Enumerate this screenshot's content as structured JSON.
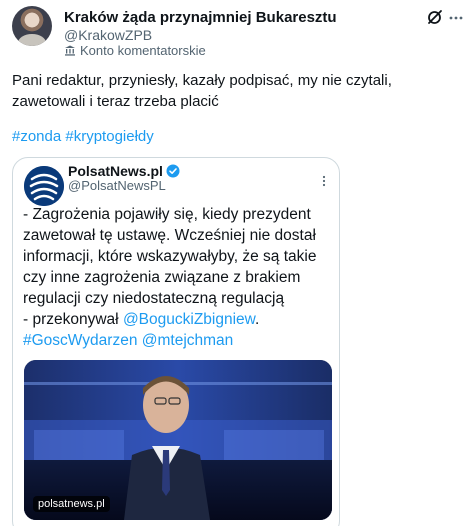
{
  "post": {
    "author_name": "Kraków żąda przynajmniej Bukaresztu",
    "author_handle": "@KrakowZPB",
    "account_type": "Konto komentatorskie",
    "icons": {
      "grok": "grok-icon",
      "more": "more-icon",
      "account": "bank-icon"
    },
    "text": "Pani redaktur, przyniesły, kazały podpisać, my nie czytali, zawetowali i teraz trzeba placić",
    "hashtags": "#zonda #kryptogiełdy"
  },
  "quote": {
    "name": "PolsatNews.pl",
    "handle": "@PolsatNewsPL",
    "verified_color": "#1d9bf0",
    "text_lines": [
      "- Zagrożenia pojawiły się, kiedy prezydent",
      "zawetował tę ustawę. Wcześniej nie dostał",
      "informacji, które wskazywałyby, że są takie",
      "czy inne zagrożenia związane z brakiem",
      "regulacji czy niedostateczną regulacją",
      "- przekonywał "
    ],
    "mention_1": "@BoguckiZbigniew",
    "line_end": ".",
    "hashtag": "#GoscWydarzen",
    "mention_2": "@mtejchman",
    "media_source": "polsatnews.pl"
  },
  "colors": {
    "link": "#1d9bf0",
    "text": "#0f1419",
    "secondary": "#536471",
    "border": "#cfd9de"
  }
}
